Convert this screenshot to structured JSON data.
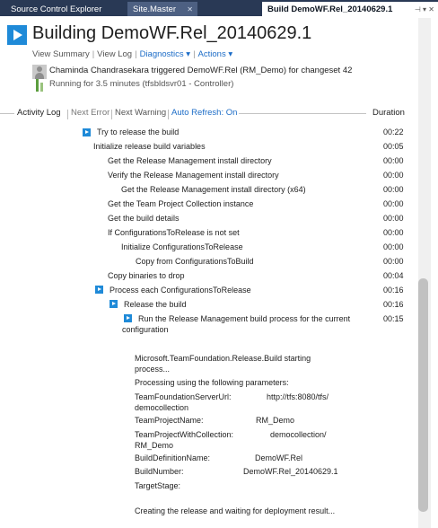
{
  "tabs": [
    {
      "label": "Source Control Explorer"
    },
    {
      "label": "Site.Master",
      "close": "✕"
    },
    {
      "label": "Build DemoWF.Rel_20140629.1",
      "controls": "⊣ ▾ ✕"
    }
  ],
  "header": {
    "title": "Building DemoWF.Rel_20140629.1",
    "links": {
      "view_summary": "View Summary",
      "view_log": "View Log",
      "diagnostics": "Diagnostics ▾",
      "actions": "Actions ▾",
      "sep": "|"
    },
    "trigger_text": "Chaminda Chandrasekara triggered DemoWF.Rel (RM_Demo) for changeset 42",
    "running_text": "Running for 3.5 minutes (tfsbldsvr01 - Controller)"
  },
  "toolbar": {
    "activity_log": "Activity Log",
    "next_error": "Next Error",
    "next_warning": "Next Warning",
    "auto_refresh": "Auto Refresh: On",
    "duration": "Duration",
    "sep": "|"
  },
  "log": [
    {
      "label": "Try to release the build",
      "duration": "00:22",
      "icon": "play-icon"
    },
    {
      "label": "Initialize release build variables",
      "duration": "00:05"
    },
    {
      "label": "Get the Release Management install directory",
      "duration": "00:00"
    },
    {
      "label": "Verify the Release Management install directory",
      "duration": "00:00"
    },
    {
      "label": "Get the Release Management install directory (x64)",
      "duration": "00:00"
    },
    {
      "label": "Get the Team Project Collection instance",
      "duration": "00:00"
    },
    {
      "label": "Get the build details",
      "duration": "00:00"
    },
    {
      "label": "If ConfigurationsToRelease is not set",
      "duration": "00:00"
    },
    {
      "label": "Initialize ConfigurationsToRelease",
      "duration": "00:00"
    },
    {
      "label": "Copy from ConfigurationsToBuild",
      "duration": "00:00"
    },
    {
      "label": "Copy binaries to drop",
      "duration": "00:04"
    },
    {
      "label": "Process each ConfigurationsToRelease",
      "duration": "00:16",
      "icon": "play-icon"
    },
    {
      "label": "Release the build",
      "duration": "00:16",
      "icon": "play-icon"
    },
    {
      "label_line1": "Run the Release Management build process for the current",
      "label_line2": "configuration",
      "duration": "00:15",
      "icon": "play-icon"
    }
  ],
  "output": {
    "starting_line1": "Microsoft.TeamFoundation.Release.Build starting",
    "starting_line2": "process...",
    "processing": "Processing using the following parameters:",
    "params": [
      {
        "key": "TeamFoundationServerUrl:",
        "value": "http://tfs:8080/tfs/",
        "value2": "democollection"
      },
      {
        "key": "TeamProjectName:",
        "value": "RM_Demo"
      },
      {
        "key": "TeamProjectWithCollection:",
        "value": "democollection/",
        "value2": "RM_Demo"
      },
      {
        "key": "BuildDefinitionName:",
        "value": "DemoWF.Rel"
      },
      {
        "key": "BuildNumber:",
        "value": "DemoWF.Rel_20140629.1"
      },
      {
        "key": "TargetStage:",
        "value": ""
      }
    ],
    "creating": "Creating the release and waiting for deployment result..."
  },
  "colors": {
    "accent": "#1f8ad8",
    "tabbar": "#293955",
    "link": "#1c6cc7",
    "progress": "#5c9e3e"
  }
}
